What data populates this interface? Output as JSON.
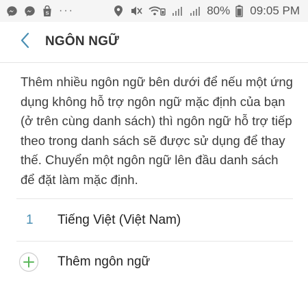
{
  "status_bar": {
    "left_icons": [
      "messenger-icon",
      "messenger-icon",
      "shop-icon"
    ],
    "overflow": "···",
    "battery": "80%",
    "time": "09:05 PM",
    "right_icons": [
      "location-icon",
      "mute-icon",
      "wifi-icon",
      "signal-icon",
      "signal-icon",
      "battery-icon"
    ]
  },
  "app_bar": {
    "title": "NGÔN NGỮ",
    "back_icon": "chevron-left-icon"
  },
  "description": "Thêm nhiều ngôn ngữ bên dưới để nếu một ứng dụng không hỗ trợ ngôn ngữ mặc định của bạn (ở trên cùng danh sách) thì ngôn ngữ hỗ trợ tiếp theo trong danh sách sẽ được sử dụng để thay thế. Chuyển một ngôn ngữ lên đầu danh sách để đặt làm mặc định.",
  "languages": [
    {
      "index": "1",
      "name": "Tiếng Việt (Việt Nam)"
    }
  ],
  "add_language": {
    "label": "Thêm ngôn ngữ",
    "icon": "plus-circle-icon"
  },
  "colors": {
    "accent": "#4a8fb3",
    "add_icon": "#5cb85c",
    "status_bar_bg": "#f5f5f5"
  }
}
